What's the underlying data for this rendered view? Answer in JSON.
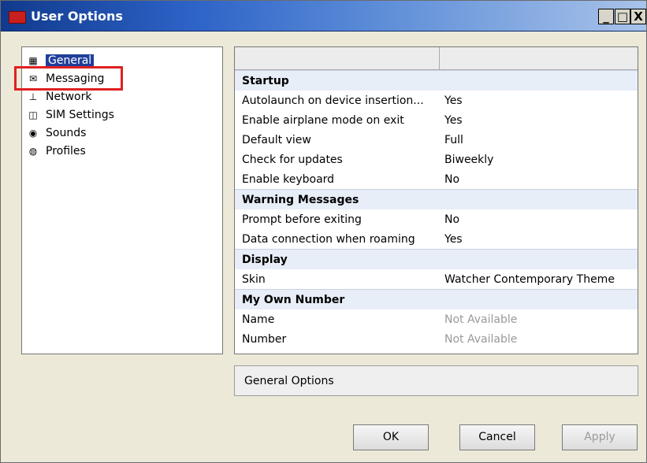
{
  "window": {
    "title": "User Options",
    "controls": {
      "minimize": "_",
      "maximize": "□",
      "close": "X"
    }
  },
  "sidebar": {
    "items": [
      {
        "label": "General",
        "icon": "general-icon",
        "selected": true
      },
      {
        "label": "Messaging",
        "icon": "envelope-icon",
        "selected": false
      },
      {
        "label": "Network",
        "icon": "network-icon",
        "selected": false
      },
      {
        "label": "SIM Settings",
        "icon": "sim-icon",
        "selected": false
      },
      {
        "label": "Sounds",
        "icon": "speaker-icon",
        "selected": false
      },
      {
        "label": "Profiles",
        "icon": "globe-icon",
        "selected": false
      }
    ]
  },
  "properties": {
    "sections": [
      {
        "title": "Startup",
        "rows": [
          {
            "name": "Autolaunch on device insertion...",
            "value": "Yes"
          },
          {
            "name": "Enable airplane mode on exit",
            "value": "Yes"
          },
          {
            "name": "Default view",
            "value": "Full"
          },
          {
            "name": "Check for updates",
            "value": "Biweekly"
          },
          {
            "name": "Enable keyboard",
            "value": "No"
          }
        ]
      },
      {
        "title": "Warning Messages",
        "rows": [
          {
            "name": "Prompt before exiting",
            "value": "No"
          },
          {
            "name": "Data connection when roaming",
            "value": "Yes"
          }
        ]
      },
      {
        "title": "Display",
        "rows": [
          {
            "name": "Skin",
            "value": "Watcher Contemporary Theme"
          }
        ]
      },
      {
        "title": "My Own Number",
        "rows": [
          {
            "name": "Name",
            "value": "Not Available",
            "muted": true
          },
          {
            "name": "Number",
            "value": "Not Available",
            "muted": true
          }
        ]
      }
    ]
  },
  "status": {
    "text": "General Options"
  },
  "buttons": {
    "ok": "OK",
    "cancel": "Cancel",
    "apply": "Apply"
  }
}
